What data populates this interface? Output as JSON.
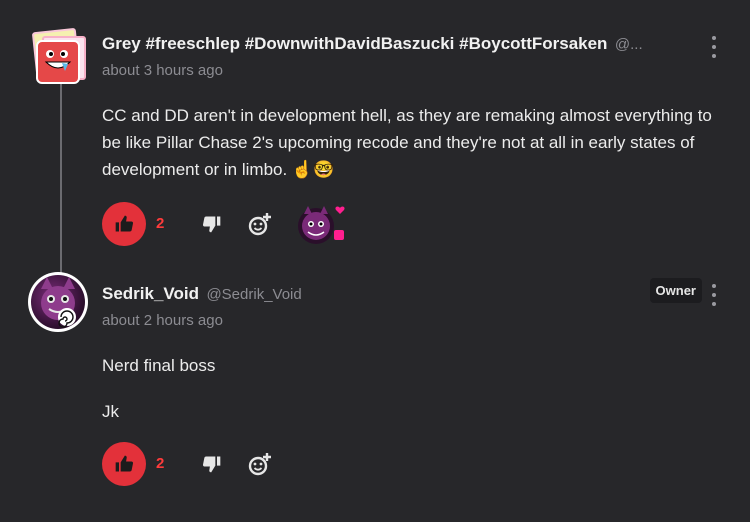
{
  "comments": [
    {
      "username": "Grey #freeschlep #DownwithDavidBaszucki #BoycottForsaken",
      "handle": "@...",
      "time": "about 3 hours ago",
      "text": "CC and DD aren't in development hell, as they are remaking almost everything to be like Pillar Chase 2's upcoming recode and they're not at all in early states of development or in limbo. ☝️🤓",
      "likes": "2"
    },
    {
      "username": "Sedrik_Void",
      "handle": "@Sedrik_Void",
      "badge": "Owner",
      "time": "about 2 hours ago",
      "paragraphs": [
        "Nerd final boss",
        "Jk"
      ],
      "likes": "2"
    }
  ],
  "colors": {
    "background": "#27272a",
    "like_red": "#e3313a",
    "muted_text": "#8c8c92"
  },
  "icons": [
    "kebab-menu-icon",
    "thumbs-up-icon",
    "thumbs-down-icon",
    "add-reaction-icon"
  ]
}
